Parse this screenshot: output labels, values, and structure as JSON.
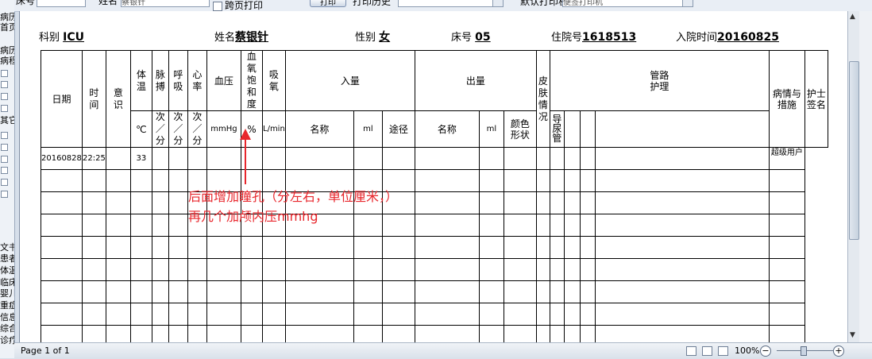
{
  "left_strip": [
    "病历",
    "首页",
    "",
    "病历",
    "病程",
    "",
    "",
    "",
    "",
    "",
    "",
    "",
    "其它",
    "",
    "",
    "",
    "",
    "",
    "",
    "",
    "",
    "",
    "",
    "",
    "文书",
    "患者",
    "体温",
    "临床",
    "婴儿",
    "重症",
    "信息",
    "综合",
    "诊疗"
  ],
  "toolbar": {
    "bed_label": "床号",
    "name_label": "姓名",
    "name_value": "蔡银针",
    "crosspage_label": "跨页打印",
    "print_button": "打印",
    "history_label": "打印历史",
    "printer_label": "默认打印机",
    "printer_value": "便签打印机"
  },
  "header": {
    "dept_label": "科别",
    "dept_value": "ICU",
    "name_label": "姓名",
    "name_value": "蔡银针",
    "sex_label": "性别",
    "sex_value": "女",
    "bed_label": "床号",
    "bed_value": "05",
    "inpatient_label": "住院号",
    "inpatient_value": "1618513",
    "admit_label": "入院时间",
    "admit_value": "20160825"
  },
  "table": {
    "date": "日期",
    "time": "时间",
    "consciousness": "意识",
    "temp": "体温",
    "pulse": "脉搏",
    "resp": "呼吸",
    "heart": "心率",
    "bp": "血压",
    "spo2": "血氧饱和度",
    "oxygen": "吸氧",
    "intake": "入量",
    "output": "出量",
    "skin": "皮肤情况",
    "tube": "管路护理",
    "condition": "病情与措施",
    "nurse": "护士签名",
    "temp_unit": "℃",
    "pulse_unit": "次／分",
    "resp_unit": "次／分",
    "heart_unit": "次／分",
    "bp_unit": "mmHg",
    "spo2_unit": "%",
    "oxygen_unit": "L/min",
    "in_name": "名称",
    "in_ml": "ml",
    "in_route": "途径",
    "out_name": "名称",
    "out_ml": "ml",
    "out_color": "颜色形状",
    "catheter": "导尿管",
    "row1": {
      "date": "20160828",
      "time": "22:25",
      "temp": "33",
      "nurse": "超级用户"
    }
  },
  "annotation": {
    "line1": "后面增加瞳孔（分左右，单位厘米，）",
    "line2": "再几个加颅内压mmhg"
  },
  "status": {
    "page": "Page 1 of 1",
    "zoom": "100%"
  },
  "colors": {
    "annotation": "#e8262c",
    "chrome": "#d6dfea"
  }
}
